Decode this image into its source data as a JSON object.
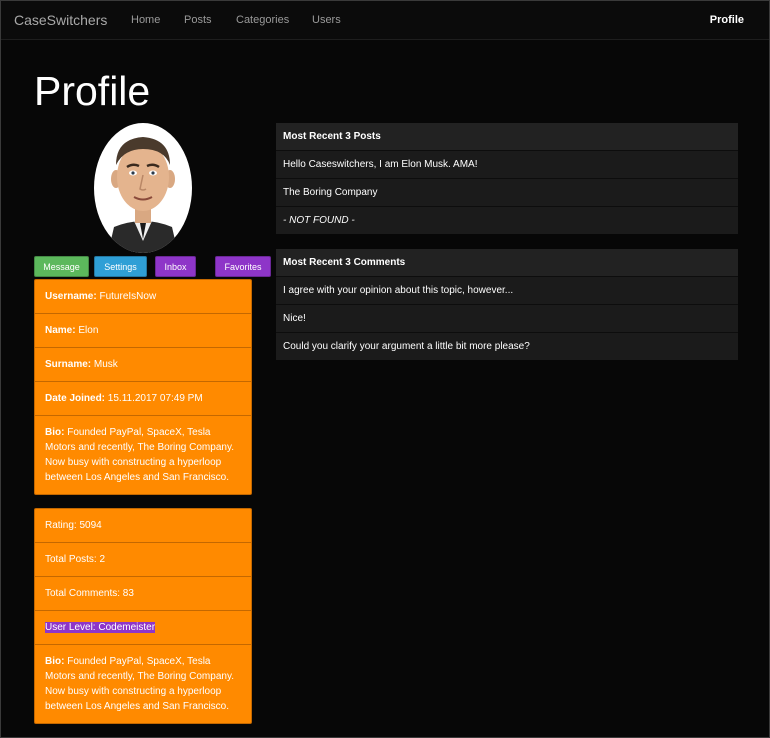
{
  "nav": {
    "brand": "CaseSwitchers",
    "links": [
      "Home",
      "Posts",
      "Categories",
      "Users"
    ],
    "profile": "Profile"
  },
  "page_title": "Profile",
  "actions": {
    "message": "Message",
    "settings": "Settings",
    "inbox": "Inbox",
    "favorites": "Favorites"
  },
  "user_info": {
    "username_label": "Username:",
    "username": "FutureIsNow",
    "name_label": "Name:",
    "name": "Elon",
    "surname_label": "Surname:",
    "surname": "Musk",
    "date_label": "Date Joined:",
    "date": "15.11.2017 07:49 PM",
    "bio_label": "Bio:",
    "bio": "Founded PayPal, SpaceX, Tesla Motors and recently, The Boring Company. Now busy with constructing a hyperloop between Los Angeles and San Francisco."
  },
  "stats": {
    "rating": "Rating: 5094",
    "total_posts": "Total Posts: 2",
    "total_comments": "Total Comments: 83",
    "user_level": "User Level: Codemeister",
    "bio_label": "Bio:",
    "bio": "Founded PayPal, SpaceX, Tesla Motors and recently, The Boring Company. Now busy with constructing a hyperloop between Los Angeles and San Francisco."
  },
  "recent_posts": {
    "title": "Most Recent 3 Posts",
    "items": [
      "Hello Caseswitchers, I am Elon Musk. AMA!",
      "The Boring Company",
      "- NOT FOUND -"
    ]
  },
  "recent_comments": {
    "title": "Most Recent 3 Comments",
    "items": [
      "I agree with your opinion about this topic, however...",
      "Nice!",
      "Could you clarify your argument a little bit more please?"
    ]
  },
  "colors": {
    "accent_orange": "#ff8a00",
    "message_green": "#5cb85c",
    "settings_blue": "#2f9fd6",
    "purple": "#8e35c8"
  },
  "avatar_icon": "caricature-avatar"
}
